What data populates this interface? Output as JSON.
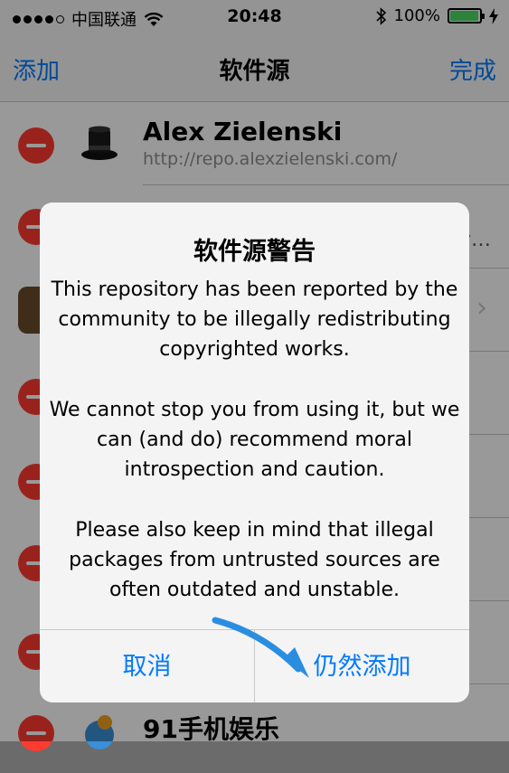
{
  "status_bar": {
    "carrier": "中国联通",
    "time": "20:48",
    "battery_percent": "100%",
    "battery_level": 1.0
  },
  "nav": {
    "add_label": "添加",
    "title": "软件源",
    "done_label": "完成"
  },
  "list": {
    "row1": {
      "name": "Alex Zielenski",
      "url": "http://repo.alexzielenski.com/"
    },
    "row2": {
      "truncated": "y…"
    },
    "row_last": {
      "name": "91手机娱乐"
    }
  },
  "alert": {
    "title": "软件源警告",
    "paragraph1": "This repository has been reported by the community to be illegally redistributing copyrighted works.",
    "paragraph2": "We cannot stop you from using it, but we can (and do) recommend moral introspection and caution.",
    "paragraph3": "Please also keep in mind that illegal packages from untrusted sources are often outdated and unstable.",
    "cancel_label": "取消",
    "confirm_label": "仍然添加"
  },
  "colors": {
    "accent": "#007aff",
    "delete_red": "#ff3b30",
    "battery_green": "#4cd964",
    "annotation_arrow": "#2a8ee0"
  },
  "icons": [
    "wifi-icon",
    "bluetooth-icon",
    "battery-icon",
    "charging-bolt-icon",
    "top-hat-icon",
    "app-icon",
    "91-logo-icon",
    "chevron-right-icon",
    "minus-circle-icon",
    "annotation-arrow"
  ]
}
